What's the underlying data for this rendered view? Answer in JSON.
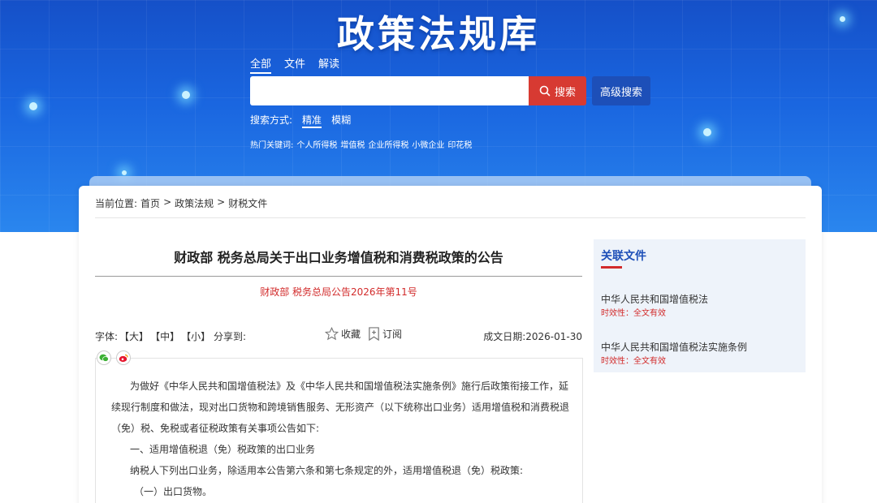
{
  "header": {
    "site_title": "政策法规库",
    "tabs": [
      "全部",
      "文件",
      "解读"
    ],
    "search_button": "搜索",
    "advanced_button": "高级搜索",
    "search_mode_label": "搜索方式:",
    "search_modes": [
      "精准",
      "模糊"
    ],
    "hot_label": "热门关键词:",
    "hot_keywords": [
      "个人所得税",
      "增值税",
      "企业所得税",
      "小微企业",
      "印花税"
    ]
  },
  "breadcrumb": {
    "label": "当前位置:",
    "items": [
      "首页",
      "政策法规",
      "财税文件"
    ]
  },
  "article": {
    "title": "财政部 税务总局关于出口业务增值税和消费税政策的公告",
    "doc_number": "财政部 税务总局公告2026年第11号",
    "font_label": "字体:",
    "font_sizes": [
      "【大】",
      "【中】",
      "【小】"
    ],
    "share_label": "分享到:",
    "favorite": "收藏",
    "subscribe": "订阅",
    "date_label": "成文日期:",
    "date": "2026-01-30",
    "paragraphs": [
      "为做好《中华人民共和国增值税法》及《中华人民共和国增值税法实施条例》施行后政策衔接工作，延",
      "续现行制度和做法，现对出口货物和跨境销售服务、无形资产（以下统称出口业务）适用增值税和消费税退",
      "（免）税、免税或者征税政策有关事项公告如下:",
      "一、适用增值税退（免）税政策的出口业务",
      "纳税人下列出口业务，除适用本公告第六条和第七条规定的外，适用增值税退（免）税政策:",
      "（一）出口货物。"
    ]
  },
  "sidebar": {
    "heading": "关联文件",
    "items": [
      {
        "title": "中华人民共和国增值税法",
        "meta": "时效性：全文有效"
      },
      {
        "title": "中华人民共和国增值税法实施条例",
        "meta": "时效性：全文有效"
      }
    ]
  },
  "colors": {
    "brand_blue": "#1d4fb8",
    "accent_red": "#d22b2b"
  }
}
